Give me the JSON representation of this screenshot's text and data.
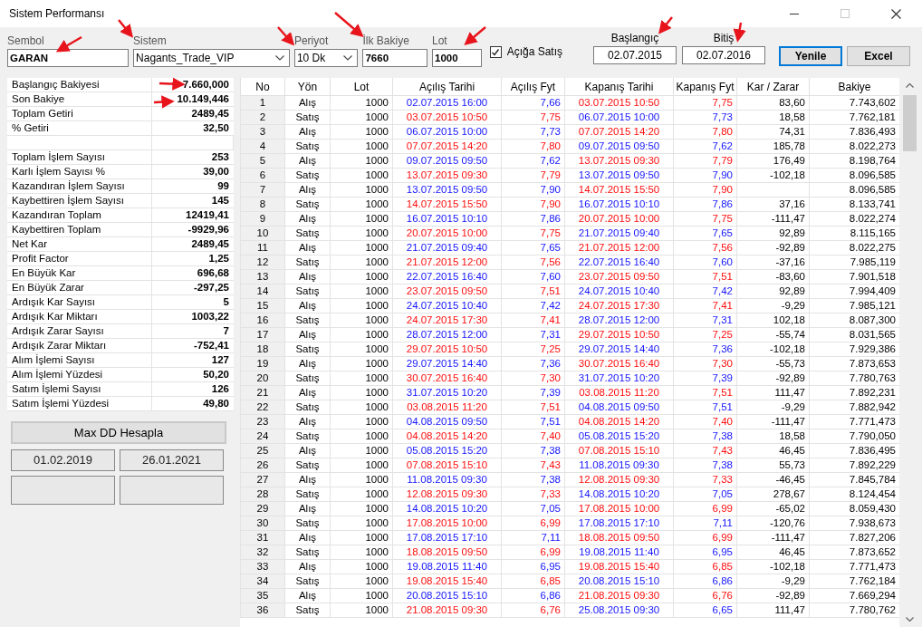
{
  "window": {
    "title": "Sistem Performansı"
  },
  "filters": [
    {
      "kind": "text",
      "label": "Sembol",
      "value": "GARAN"
    },
    {
      "kind": "select",
      "label": "Sistem",
      "value": "Nagants_Trade_VIP"
    },
    {
      "kind": "select",
      "label": "Periyot",
      "value": "10 Dk"
    },
    {
      "kind": "text",
      "label": "İlk Bakiye",
      "value": "7660"
    },
    {
      "kind": "text",
      "label": "Lot",
      "value": "1000"
    },
    {
      "kind": "checkbox",
      "label": "Açığa Satış",
      "checked": true
    }
  ],
  "date_range": [
    {
      "label": "Başlangıç",
      "value": "02.07.2015"
    },
    {
      "label": "Bitiş",
      "value": "02.07.2016"
    }
  ],
  "buttons": [
    {
      "label": "Yenile",
      "focused": true
    },
    {
      "label": "Excel",
      "focused": false
    }
  ],
  "summary": [
    {
      "kind": "stat",
      "label": "Başlangıç Bakiyesi",
      "value": "7.660,000"
    },
    {
      "kind": "stat",
      "label": "Son Bakiye",
      "value": "10.149,446"
    },
    {
      "kind": "stat",
      "label": "Toplam Getiri",
      "value": "2489,45"
    },
    {
      "kind": "stat",
      "label": "% Getiri",
      "value": "32,50"
    },
    {
      "kind": "blank"
    },
    {
      "kind": "stat",
      "label": "Toplam İşlem Sayısı",
      "value": "253"
    },
    {
      "kind": "stat",
      "label": "Karlı İşlem Sayısı %",
      "value": "39,00"
    },
    {
      "kind": "stat",
      "label": "Kazandıran İşlem Sayısı",
      "value": "99"
    },
    {
      "kind": "stat",
      "label": "Kaybettiren İşlem Sayısı",
      "value": "145"
    },
    {
      "kind": "stat",
      "label": "Kazandıran Toplam",
      "value": "12419,41"
    },
    {
      "kind": "stat",
      "label": "Kaybettiren Toplam",
      "value": "-9929,96"
    },
    {
      "kind": "stat",
      "label": "Net Kar",
      "value": "2489,45"
    },
    {
      "kind": "stat",
      "label": "Profit Factor",
      "value": "1,25"
    },
    {
      "kind": "stat",
      "label": "En Büyük Kar",
      "value": "696,68"
    },
    {
      "kind": "stat",
      "label": "En Büyük Zarar",
      "value": "-297,25"
    },
    {
      "kind": "stat",
      "label": "Ardışık Kar Sayısı",
      "value": "5"
    },
    {
      "kind": "stat",
      "label": "Ardışık Kar Miktarı",
      "value": "1003,22"
    },
    {
      "kind": "stat",
      "label": "Ardışık Zarar Sayısı",
      "value": "7"
    },
    {
      "kind": "stat",
      "label": "Ardışık Zarar Miktarı",
      "value": "-752,41"
    },
    {
      "kind": "stat",
      "label": "Alım İşlemi Sayısı",
      "value": "127"
    },
    {
      "kind": "stat",
      "label": "Alım İşlemi Yüzdesi",
      "value": "50,20"
    },
    {
      "kind": "stat",
      "label": "Satım İşlemi Sayısı",
      "value": "126"
    },
    {
      "kind": "stat",
      "label": "Satım İşlemi Yüzdesi",
      "value": "49,80"
    }
  ],
  "max_dd": {
    "button": "Max DD Hesapla",
    "dates": [
      "01.02.2019",
      "26.01.2021"
    ]
  },
  "table": {
    "columns": [
      "No",
      "Yön",
      "Lot",
      "Açılış Tarihi",
      "Açılış Fyt",
      "Kapanış Tarihi",
      "Kapanış Fyt",
      "Kar / Zarar",
      "Bakiye"
    ],
    "rows": [
      {
        "kind": "buy",
        "no": "1",
        "side": "Alış",
        "lot": "1000",
        "open_date": "02.07.2015 16:00",
        "open_price": "7,66",
        "close_date": "03.07.2015 10:50",
        "close_price": "7,75",
        "pnl": "83,60",
        "balance": "7.743,602"
      },
      {
        "kind": "sell",
        "no": "2",
        "side": "Satış",
        "lot": "1000",
        "open_date": "03.07.2015 10:50",
        "open_price": "7,75",
        "close_date": "06.07.2015 10:00",
        "close_price": "7,73",
        "pnl": "18,58",
        "balance": "7.762,181"
      },
      {
        "kind": "buy",
        "no": "3",
        "side": "Alış",
        "lot": "1000",
        "open_date": "06.07.2015 10:00",
        "open_price": "7,73",
        "close_date": "07.07.2015 14:20",
        "close_price": "7,80",
        "pnl": "74,31",
        "balance": "7.836,493"
      },
      {
        "kind": "sell",
        "no": "4",
        "side": "Satış",
        "lot": "1000",
        "open_date": "07.07.2015 14:20",
        "open_price": "7,80",
        "close_date": "09.07.2015 09:50",
        "close_price": "7,62",
        "pnl": "185,78",
        "balance": "8.022,273"
      },
      {
        "kind": "buy",
        "no": "5",
        "side": "Alış",
        "lot": "1000",
        "open_date": "09.07.2015 09:50",
        "open_price": "7,62",
        "close_date": "13.07.2015 09:30",
        "close_price": "7,79",
        "pnl": "176,49",
        "balance": "8.198,764"
      },
      {
        "kind": "sell",
        "no": "6",
        "side": "Satış",
        "lot": "1000",
        "open_date": "13.07.2015 09:30",
        "open_price": "7,79",
        "close_date": "13.07.2015 09:50",
        "close_price": "7,90",
        "pnl": "-102,18",
        "balance": "8.096,585"
      },
      {
        "kind": "buy",
        "no": "7",
        "side": "Alış",
        "lot": "1000",
        "open_date": "13.07.2015 09:50",
        "open_price": "7,90",
        "close_date": "14.07.2015 15:50",
        "close_price": "7,90",
        "balance": "8.096,585"
      },
      {
        "kind": "sell",
        "no": "8",
        "side": "Satış",
        "lot": "1000",
        "open_date": "14.07.2015 15:50",
        "open_price": "7,90",
        "close_date": "16.07.2015 10:10",
        "close_price": "7,86",
        "pnl": "37,16",
        "balance": "8.133,741"
      },
      {
        "kind": "buy",
        "no": "9",
        "side": "Alış",
        "lot": "1000",
        "open_date": "16.07.2015 10:10",
        "open_price": "7,86",
        "close_date": "20.07.2015 10:00",
        "close_price": "7,75",
        "pnl": "-111,47",
        "balance": "8.022,274"
      },
      {
        "kind": "sell",
        "no": "10",
        "side": "Satış",
        "lot": "1000",
        "open_date": "20.07.2015 10:00",
        "open_price": "7,75",
        "close_date": "21.07.2015 09:40",
        "close_price": "7,65",
        "pnl": "92,89",
        "balance": "8.115,165"
      },
      {
        "kind": "buy",
        "no": "11",
        "side": "Alış",
        "lot": "1000",
        "open_date": "21.07.2015 09:40",
        "open_price": "7,65",
        "close_date": "21.07.2015 12:00",
        "close_price": "7,56",
        "pnl": "-92,89",
        "balance": "8.022,275"
      },
      {
        "kind": "sell",
        "no": "12",
        "side": "Satış",
        "lot": "1000",
        "open_date": "21.07.2015 12:00",
        "open_price": "7,56",
        "close_date": "22.07.2015 16:40",
        "close_price": "7,60",
        "pnl": "-37,16",
        "balance": "7.985,119"
      },
      {
        "kind": "buy",
        "no": "13",
        "side": "Alış",
        "lot": "1000",
        "open_date": "22.07.2015 16:40",
        "open_price": "7,60",
        "close_date": "23.07.2015 09:50",
        "close_price": "7,51",
        "pnl": "-83,60",
        "balance": "7.901,518"
      },
      {
        "kind": "sell",
        "no": "14",
        "side": "Satış",
        "lot": "1000",
        "open_date": "23.07.2015 09:50",
        "open_price": "7,51",
        "close_date": "24.07.2015 10:40",
        "close_price": "7,42",
        "pnl": "92,89",
        "balance": "7.994,409"
      },
      {
        "kind": "buy",
        "no": "15",
        "side": "Alış",
        "lot": "1000",
        "open_date": "24.07.2015 10:40",
        "open_price": "7,42",
        "close_date": "24.07.2015 17:30",
        "close_price": "7,41",
        "pnl": "-9,29",
        "balance": "7.985,121"
      },
      {
        "kind": "sell",
        "no": "16",
        "side": "Satış",
        "lot": "1000",
        "open_date": "24.07.2015 17:30",
        "open_price": "7,41",
        "close_date": "28.07.2015 12:00",
        "close_price": "7,31",
        "pnl": "102,18",
        "balance": "8.087,300"
      },
      {
        "kind": "buy",
        "no": "17",
        "side": "Alış",
        "lot": "1000",
        "open_date": "28.07.2015 12:00",
        "open_price": "7,31",
        "close_date": "29.07.2015 10:50",
        "close_price": "7,25",
        "pnl": "-55,74",
        "balance": "8.031,565"
      },
      {
        "kind": "sell",
        "no": "18",
        "side": "Satış",
        "lot": "1000",
        "open_date": "29.07.2015 10:50",
        "open_price": "7,25",
        "close_date": "29.07.2015 14:40",
        "close_price": "7,36",
        "pnl": "-102,18",
        "balance": "7.929,386"
      },
      {
        "kind": "buy",
        "no": "19",
        "side": "Alış",
        "lot": "1000",
        "open_date": "29.07.2015 14:40",
        "open_price": "7,36",
        "close_date": "30.07.2015 16:40",
        "close_price": "7,30",
        "pnl": "-55,73",
        "balance": "7.873,653"
      },
      {
        "kind": "sell",
        "no": "20",
        "side": "Satış",
        "lot": "1000",
        "open_date": "30.07.2015 16:40",
        "open_price": "7,30",
        "close_date": "31.07.2015 10:20",
        "close_price": "7,39",
        "pnl": "-92,89",
        "balance": "7.780,763"
      },
      {
        "kind": "buy",
        "no": "21",
        "side": "Alış",
        "lot": "1000",
        "open_date": "31.07.2015 10:20",
        "open_price": "7,39",
        "close_date": "03.08.2015 11:20",
        "close_price": "7,51",
        "pnl": "111,47",
        "balance": "7.892,231"
      },
      {
        "kind": "sell",
        "no": "22",
        "side": "Satış",
        "lot": "1000",
        "open_date": "03.08.2015 11:20",
        "open_price": "7,51",
        "close_date": "04.08.2015 09:50",
        "close_price": "7,51",
        "pnl": "-9,29",
        "balance": "7.882,942"
      },
      {
        "kind": "buy",
        "no": "23",
        "side": "Alış",
        "lot": "1000",
        "open_date": "04.08.2015 09:50",
        "open_price": "7,51",
        "close_date": "04.08.2015 14:20",
        "close_price": "7,40",
        "pnl": "-111,47",
        "balance": "7.771,473"
      },
      {
        "kind": "sell",
        "no": "24",
        "side": "Satış",
        "lot": "1000",
        "open_date": "04.08.2015 14:20",
        "open_price": "7,40",
        "close_date": "05.08.2015 15:20",
        "close_price": "7,38",
        "pnl": "18,58",
        "balance": "7.790,050"
      },
      {
        "kind": "buy",
        "no": "25",
        "side": "Alış",
        "lot": "1000",
        "open_date": "05.08.2015 15:20",
        "open_price": "7,38",
        "close_date": "07.08.2015 15:10",
        "close_price": "7,43",
        "pnl": "46,45",
        "balance": "7.836,495"
      },
      {
        "kind": "sell",
        "no": "26",
        "side": "Satış",
        "lot": "1000",
        "open_date": "07.08.2015 15:10",
        "open_price": "7,43",
        "close_date": "11.08.2015 09:30",
        "close_price": "7,38",
        "pnl": "55,73",
        "balance": "7.892,229"
      },
      {
        "kind": "buy",
        "no": "27",
        "side": "Alış",
        "lot": "1000",
        "open_date": "11.08.2015 09:30",
        "open_price": "7,38",
        "close_date": "12.08.2015 09:30",
        "close_price": "7,33",
        "pnl": "-46,45",
        "balance": "7.845,784"
      },
      {
        "kind": "sell",
        "no": "28",
        "side": "Satış",
        "lot": "1000",
        "open_date": "12.08.2015 09:30",
        "open_price": "7,33",
        "close_date": "14.08.2015 10:20",
        "close_price": "7,05",
        "pnl": "278,67",
        "balance": "8.124,454"
      },
      {
        "kind": "buy",
        "no": "29",
        "side": "Alış",
        "lot": "1000",
        "open_date": "14.08.2015 10:20",
        "open_price": "7,05",
        "close_date": "17.08.2015 10:00",
        "close_price": "6,99",
        "pnl": "-65,02",
        "balance": "8.059,430"
      },
      {
        "kind": "sell",
        "no": "30",
        "side": "Satış",
        "lot": "1000",
        "open_date": "17.08.2015 10:00",
        "open_price": "6,99",
        "close_date": "17.08.2015 17:10",
        "close_price": "7,11",
        "pnl": "-120,76",
        "balance": "7.938,673"
      },
      {
        "kind": "buy",
        "no": "31",
        "side": "Alış",
        "lot": "1000",
        "open_date": "17.08.2015 17:10",
        "open_price": "7,11",
        "close_date": "18.08.2015 09:50",
        "close_price": "6,99",
        "pnl": "-111,47",
        "balance": "7.827,206"
      },
      {
        "kind": "sell",
        "no": "32",
        "side": "Satış",
        "lot": "1000",
        "open_date": "18.08.2015 09:50",
        "open_price": "6,99",
        "close_date": "19.08.2015 11:40",
        "close_price": "6,95",
        "pnl": "46,45",
        "balance": "7.873,652"
      },
      {
        "kind": "buy",
        "no": "33",
        "side": "Alış",
        "lot": "1000",
        "open_date": "19.08.2015 11:40",
        "open_price": "6,95",
        "close_date": "19.08.2015 15:40",
        "close_price": "6,85",
        "pnl": "-102,18",
        "balance": "7.771,473"
      },
      {
        "kind": "sell",
        "no": "34",
        "side": "Satış",
        "lot": "1000",
        "open_date": "19.08.2015 15:40",
        "open_price": "6,85",
        "close_date": "20.08.2015 15:10",
        "close_price": "6,86",
        "pnl": "-9,29",
        "balance": "7.762,184"
      },
      {
        "kind": "buy",
        "no": "35",
        "side": "Alış",
        "lot": "1000",
        "open_date": "20.08.2015 15:10",
        "open_price": "6,86",
        "close_date": "21.08.2015 09:30",
        "close_price": "6,76",
        "pnl": "-92,89",
        "balance": "7.669,294"
      },
      {
        "kind": "sell",
        "no": "36",
        "side": "Satış",
        "lot": "1000",
        "open_date": "21.08.2015 09:30",
        "open_price": "6,76",
        "close_date": "25.08.2015 09:30",
        "close_price": "6,65",
        "pnl": "111,47",
        "balance": "7.780,762"
      }
    ]
  }
}
